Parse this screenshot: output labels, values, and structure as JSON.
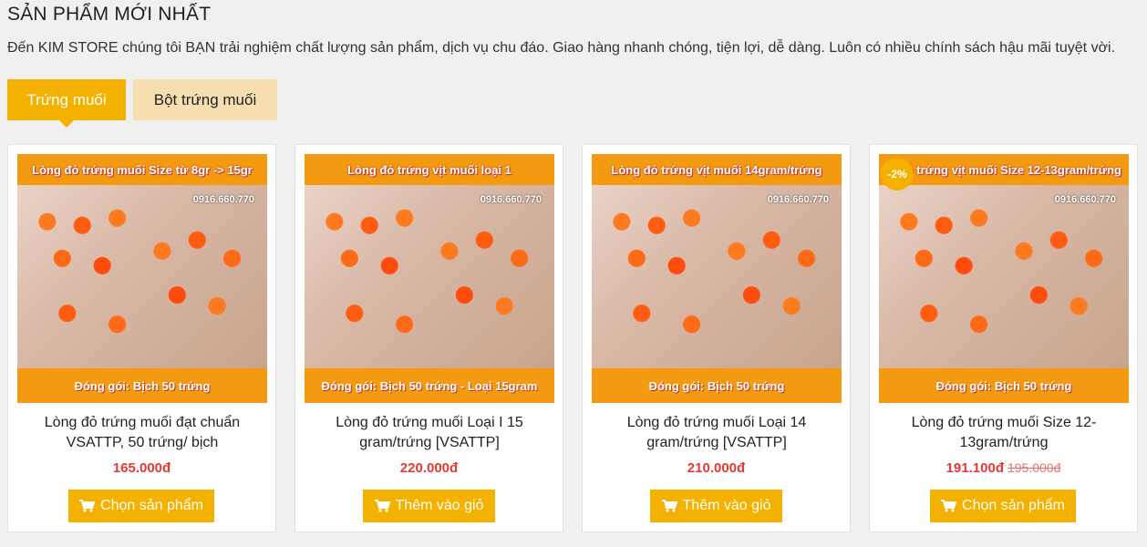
{
  "section": {
    "title": "SẢN PHẨM MỚI NHẤT",
    "intro": "Đến KIM STORE chúng tôi BẠN trải nghiệm chất lượng sản phẩm, dịch vụ chu đáo. Giao hàng nhanh chóng, tiện lợi, dễ dàng. Luôn có nhiều chính sách hậu mãi tuyệt vời."
  },
  "tabs": [
    {
      "label": "Trứng muối",
      "active": true
    },
    {
      "label": "Bột trứng muối",
      "active": false
    }
  ],
  "products": [
    {
      "image_top": "Lòng đỏ trứng muối Size từ 8gr -> 15gr",
      "image_bottom": "Đóng gói: Bịch 50 trứng",
      "image_phone": "0916.660.770",
      "name": "Lòng đỏ trứng muối đạt chuẩn VSATTP, 50 trứng/ bịch",
      "price": "165.000đ",
      "button": "Chọn sản phẩm"
    },
    {
      "image_top": "Lòng đỏ trứng vịt muối loại 1",
      "image_bottom": "Đóng gói: Bịch 50 trứng - Loại 15gram",
      "image_phone": "0916.660.770",
      "name": "Lòng đỏ trứng muối Loại I 15 gram/trứng [VSATTP]",
      "price": "220.000đ",
      "button": "Thêm vào giỏ"
    },
    {
      "image_top": "Lòng đỏ trứng vịt muối 14gram/trứng",
      "image_bottom": "Đóng gói: Bịch 50 trứng",
      "image_phone": "0916.660.770",
      "name": "Lòng đỏ trứng muối Loại 14 gram/trứng [VSATTP]",
      "price": "210.000đ",
      "button": "Thêm vào giỏ"
    },
    {
      "image_top": "đỏ trứng vịt muối Size 12-13gram/trứng",
      "image_bottom": "Đóng gói: Bịch 50 trứng",
      "image_phone": "0916.660.770",
      "discount": "-2%",
      "name": "Lòng đỏ trứng muối Size 12-13gram/trứng",
      "price": "191.100đ",
      "old_price": "195.000đ",
      "button": "Chọn sản phẩm"
    }
  ],
  "colors": {
    "accent": "#f5b100",
    "price": "#e53935",
    "tab_inactive": "#f7deb0"
  }
}
